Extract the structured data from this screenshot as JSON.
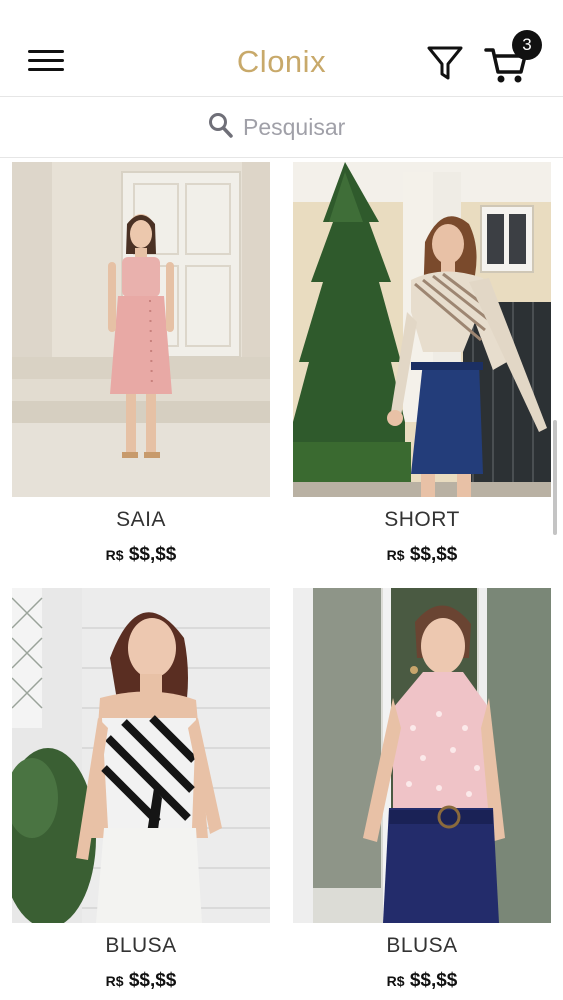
{
  "header": {
    "brand": "Clonix",
    "cart_count": "3"
  },
  "search": {
    "placeholder": "Pesquisar"
  },
  "products": [
    {
      "name": "SAIA",
      "currency": "R$",
      "price": "$$,$$"
    },
    {
      "name": "SHORT",
      "currency": "R$",
      "price": "$$,$$"
    },
    {
      "name": "BLUSA",
      "currency": "R$",
      "price": "$$,$$"
    },
    {
      "name": "BLUSA",
      "currency": "R$",
      "price": "$$,$$"
    }
  ],
  "icons": [
    "menu-icon",
    "filter-icon",
    "cart-icon",
    "search-icon"
  ],
  "colors": {
    "brand": "#c8a96a",
    "text": "#111111",
    "placeholder": "#a0a0a8"
  }
}
